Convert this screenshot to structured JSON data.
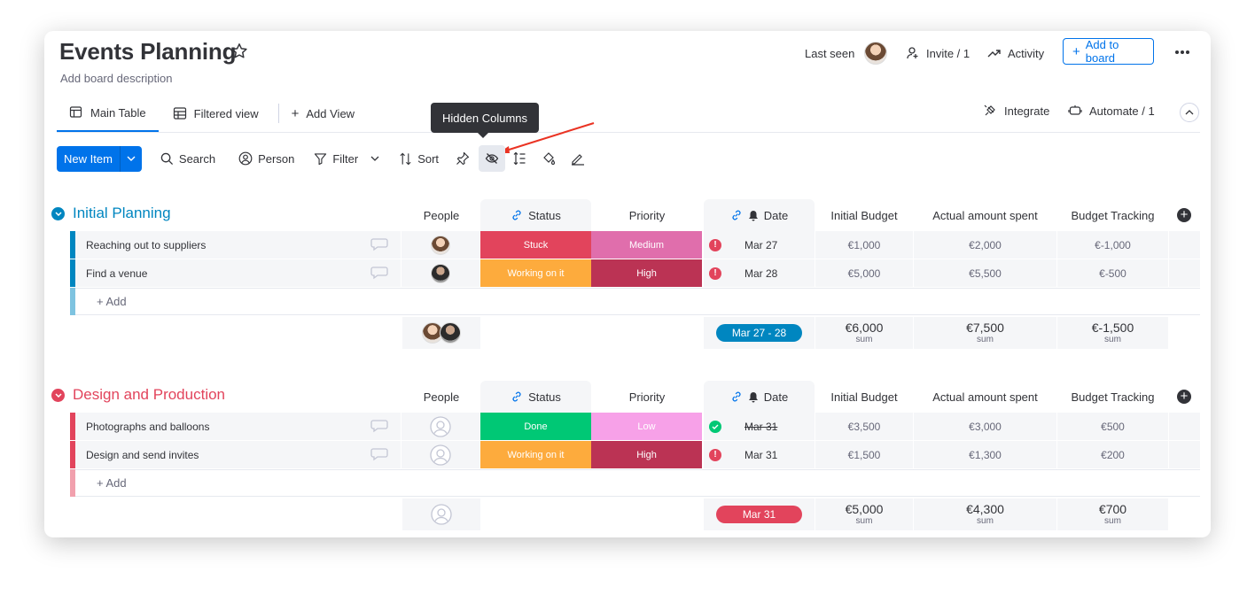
{
  "board": {
    "title": "Events Planning",
    "description": "Add board description"
  },
  "header": {
    "last_seen": "Last seen",
    "invite": "Invite / 1",
    "activity": "Activity",
    "add_to_board": "Add to board"
  },
  "tabs": {
    "main_table": "Main Table",
    "filtered_view": "Filtered view",
    "add_view": "Add View",
    "integrate": "Integrate",
    "automate": "Automate / 1"
  },
  "toolbar": {
    "new_item": "New Item",
    "search": "Search",
    "person": "Person",
    "filter": "Filter",
    "sort": "Sort",
    "tooltip": "Hidden Columns"
  },
  "columns": {
    "people": "People",
    "status": "Status",
    "priority": "Priority",
    "date": "Date",
    "initial_budget": "Initial Budget",
    "actual_spent": "Actual amount spent",
    "budget_tracking": "Budget Tracking"
  },
  "groups": [
    {
      "title": "Initial Planning",
      "color": "#0086c0",
      "rows": [
        {
          "name": "Reaching out to suppliers",
          "status": "Stuck",
          "status_color": "#e2445c",
          "priority": "Medium",
          "priority_color": "#e06eac",
          "date": "Mar 27",
          "date_state": "overdue",
          "initial": "€1,000",
          "actual": "€2,000",
          "tracking": "€-1,000"
        },
        {
          "name": "Find a venue",
          "status": "Working on it",
          "status_color": "#fdab3d",
          "priority": "High",
          "priority_color": "#bb3354",
          "date": "Mar 28",
          "date_state": "overdue",
          "initial": "€5,000",
          "actual": "€5,500",
          "tracking": "€-500"
        }
      ],
      "add_label": "+ Add",
      "summary": {
        "date_range": "Mar 27 - 28",
        "date_color": "#0086c0",
        "initial": "€6,000",
        "actual": "€7,500",
        "tracking": "€-1,500",
        "label": "sum"
      }
    },
    {
      "title": "Design and Production",
      "color": "#e2445c",
      "rows": [
        {
          "name": "Photographs and balloons",
          "status": "Done",
          "status_color": "#00c875",
          "priority": "Low",
          "priority_color": "#f7a1e8",
          "date": "Mar 31",
          "date_state": "done",
          "initial": "€3,500",
          "actual": "€3,000",
          "tracking": "€500"
        },
        {
          "name": "Design and send invites",
          "status": "Working on it",
          "status_color": "#fdab3d",
          "priority": "High",
          "priority_color": "#bb3354",
          "date": "Mar 31",
          "date_state": "overdue",
          "initial": "€1,500",
          "actual": "€1,300",
          "tracking": "€200"
        }
      ],
      "add_label": "+ Add",
      "summary": {
        "date_range": "Mar 31",
        "date_color": "#e2445c",
        "initial": "€5,000",
        "actual": "€4,300",
        "tracking": "€700",
        "label": "sum"
      }
    }
  ]
}
